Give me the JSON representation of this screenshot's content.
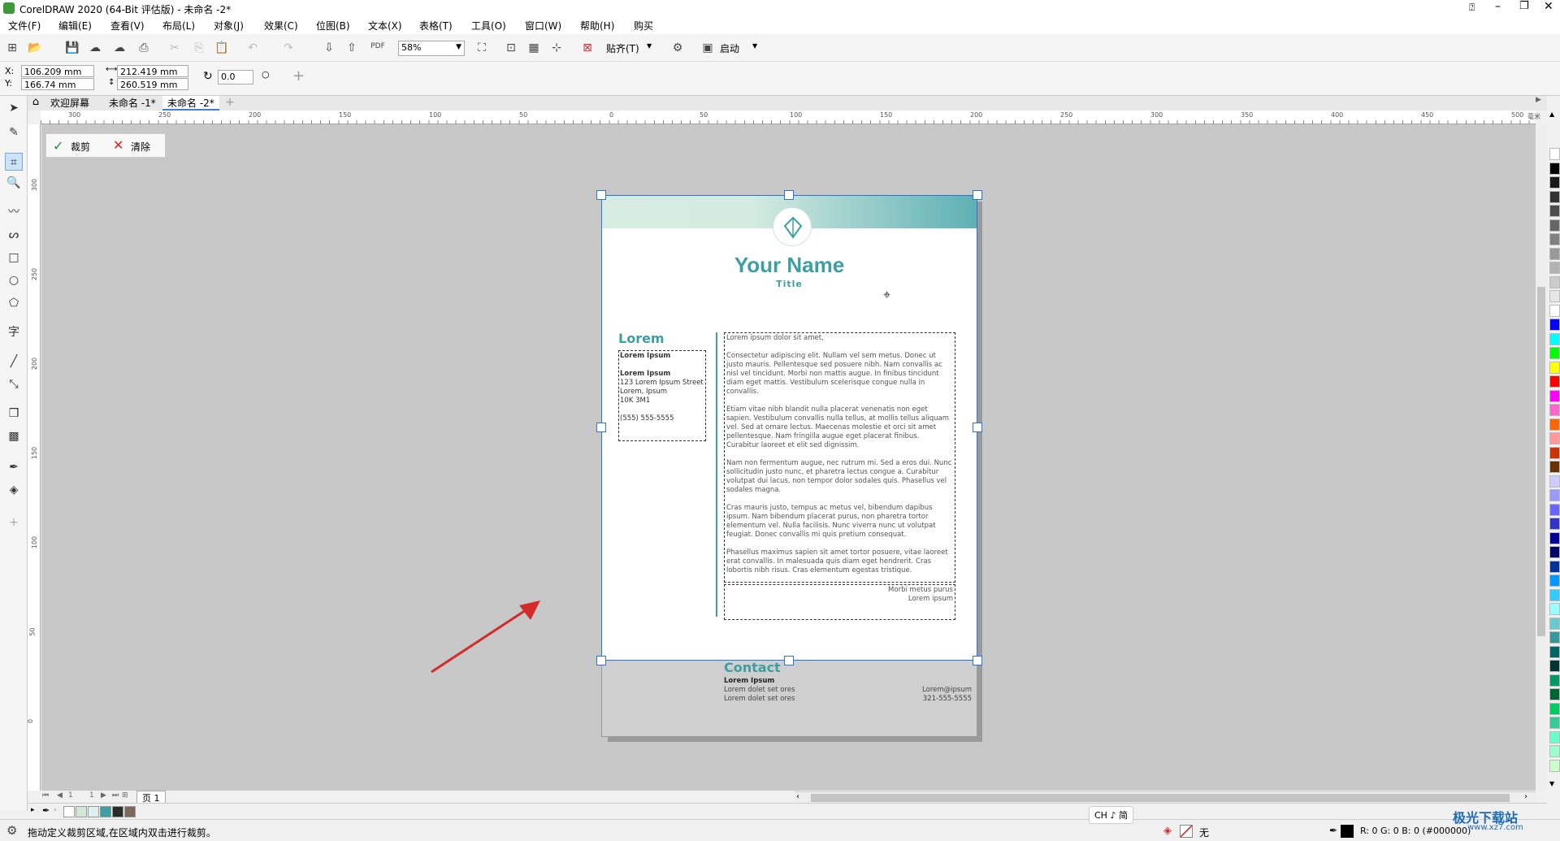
{
  "app": {
    "title": "CorelDRAW 2020 (64-Bit 评估版) - 未命名 -2*"
  },
  "menu": [
    "文件(F)",
    "编辑(E)",
    "查看(V)",
    "布局(L)",
    "对象(J)",
    "效果(C)",
    "位图(B)",
    "文本(X)",
    "表格(T)",
    "工具(O)",
    "窗口(W)",
    "帮助(H)",
    "购买"
  ],
  "toolbar": {
    "zoom": "58%",
    "snap_label": "贴齐(T)",
    "launch_label": "启动"
  },
  "props": {
    "x_label": "X:",
    "y_label": "Y:",
    "x": "106.209 mm",
    "y": "166.74 mm",
    "width": "212.419 mm",
    "height": "260.519 mm",
    "rotation": "0.0"
  },
  "tabs": [
    "欢迎屏幕",
    "未命名 -1*",
    "未命名 -2*"
  ],
  "ruler": {
    "h": [
      "300",
      "250",
      "200",
      "150",
      "100",
      "50",
      "0",
      "50",
      "100",
      "150",
      "200",
      "250",
      "300",
      "350",
      "400",
      "450",
      "500"
    ],
    "v": [
      "300",
      "250",
      "200",
      "150",
      "100",
      "50",
      "0"
    ],
    "unit": "毫米"
  },
  "crop": {
    "apply": "裁剪",
    "clear": "清除"
  },
  "document": {
    "name": "Your Name",
    "title": "Title",
    "left_heading": "Lorem",
    "left_box": {
      "line1": "Lorem Ipsum",
      "line2": "Lorem Ipsum",
      "line3": "123 Lorem Ipsum Street",
      "line4": "Lorem, Ipsum",
      "line5": "10K 3M1",
      "line6": "(555) 555-5555"
    },
    "intro": "Lorem ipsum dolor sit amet,",
    "p1": "Consectetur adipiscing elit. Nullam vel sem metus. Donec ut justo mauris. Pellentesque sed posuere nibh. Nam convallis ac nisl vel tincidunt. Morbi non mattis augue. In finibus tincidunt diam eget mattis. Vestibulum scelerisque congue nulla in convallis.",
    "p2": "Etiam vitae nibh blandit nulla placerat venenatis non eget sapien. Vestibulum convallis nulla tellus, at mollis tellus aliquam vel. Sed at ornare lectus. Maecenas molestie et orci sit amet pellentesque. Nam fringilla augue eget placerat finibus. Curabitur laoreet et elit sed dignissim.",
    "p3": "Nam non fermentum augue, nec rutrum mi. Sed a eros dui. Nunc sollicitudin justo nunc, et pharetra lectus congue a. Curabitur volutpat dui lacus, non tempor dolor sodales quis. Phasellus vel sodales magna.",
    "p4": "Cras mauris justo, tempus ac metus vel, bibendum dapibus ipsum. Nam bibendum placerat purus, non pharetra tortor elementum vel. Nulla facilisis. Nunc viverra nunc ut volutpat feugiat. Donec convallis mi quis pretium consequat.",
    "p5": "Phasellus maximus sapien sit amet tortor posuere, vitae laoreet erat convallis. In malesuada quis diam eget hendrerit. Cras lobortis nibh risus. Cras elementum egestas tristique.",
    "sign1": "Morbi metus purus",
    "sign2": "Lorem ipsum",
    "contact_heading": "Contact",
    "contact_name": "Lorem Ipsum",
    "contact_l1": "Lorem dolet set ores",
    "contact_l2": "Lorem dolet set ores",
    "contact_r1": "Lorem@ipsum",
    "contact_r2": "321-555-5555"
  },
  "page_nav": {
    "current": "1",
    "total": "1",
    "tab": "页 1"
  },
  "ime": "CH ♪ 简",
  "status": {
    "hint": "拖动定义裁剪区域,在区域内双击进行裁剪。",
    "fill_none": "无",
    "color_readout": "R: 0 G: 0 B: 0 (#000000)"
  },
  "watermark": "极光下载站",
  "watermark_url": "www.xz7.com",
  "colors": {
    "accent": "#3d9fa3",
    "handle": "#2b73d8",
    "arrow": "#d42a2a"
  },
  "palette": [
    "#ffffff",
    "#000000",
    "#1a1a1a",
    "#333333",
    "#4d4d4d",
    "#666666",
    "#808080",
    "#999999",
    "#b3b3b3",
    "#cccccc",
    "#e6e6e6",
    "#ffffff",
    "#0000ff",
    "#00ffff",
    "#00ff00",
    "#ffff00",
    "#ff0000",
    "#ff00ff",
    "#ff66cc",
    "#ff6600",
    "#ff9999",
    "#cc3300",
    "#663300",
    "#ccccff",
    "#9999ff",
    "#6666ff",
    "#3333cc",
    "#000099",
    "#000066",
    "#003399",
    "#0099ff",
    "#33ccff",
    "#99ffff",
    "#66cccc",
    "#339999",
    "#006666",
    "#003333",
    "#009966",
    "#006633",
    "#00cc66",
    "#33cc99",
    "#66ffcc",
    "#99ffcc",
    "#ccffcc"
  ],
  "bottom_palette": [
    "#ffffff",
    "#cfe8d8",
    "#e0f0f0",
    "#3d9fa3",
    "#2b2b2b",
    "#7a6a5a"
  ]
}
